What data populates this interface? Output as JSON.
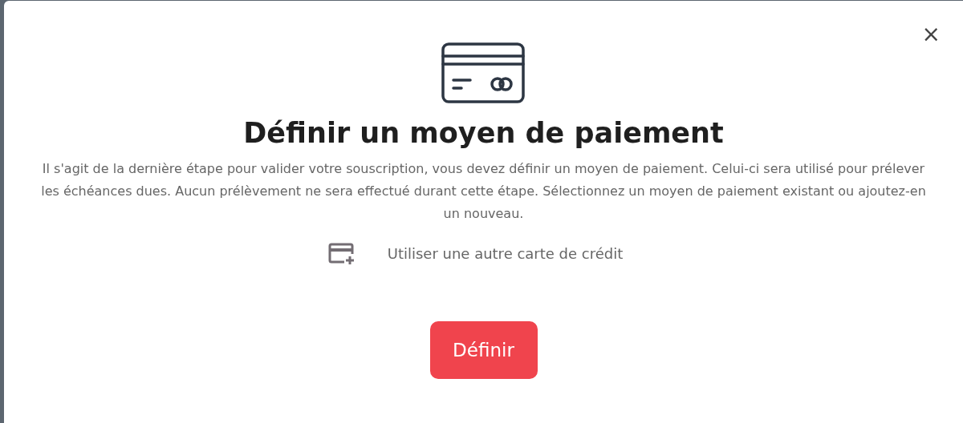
{
  "dialog": {
    "close": "×",
    "title": "Définir un moyen de paiement",
    "description": "Il s'agit de la dernière étape pour valider votre souscription, vous devez définir un moyen de paiement. Celui-ci sera utilisé pour prélever les échéances dues. Aucun prélèvement ne sera effectué durant cette étape. Sélectionnez un moyen de paiement existant ou ajoutez-en un nouveau.",
    "option": {
      "label": "Utiliser une autre carte de crédit"
    },
    "button": "Définir"
  }
}
